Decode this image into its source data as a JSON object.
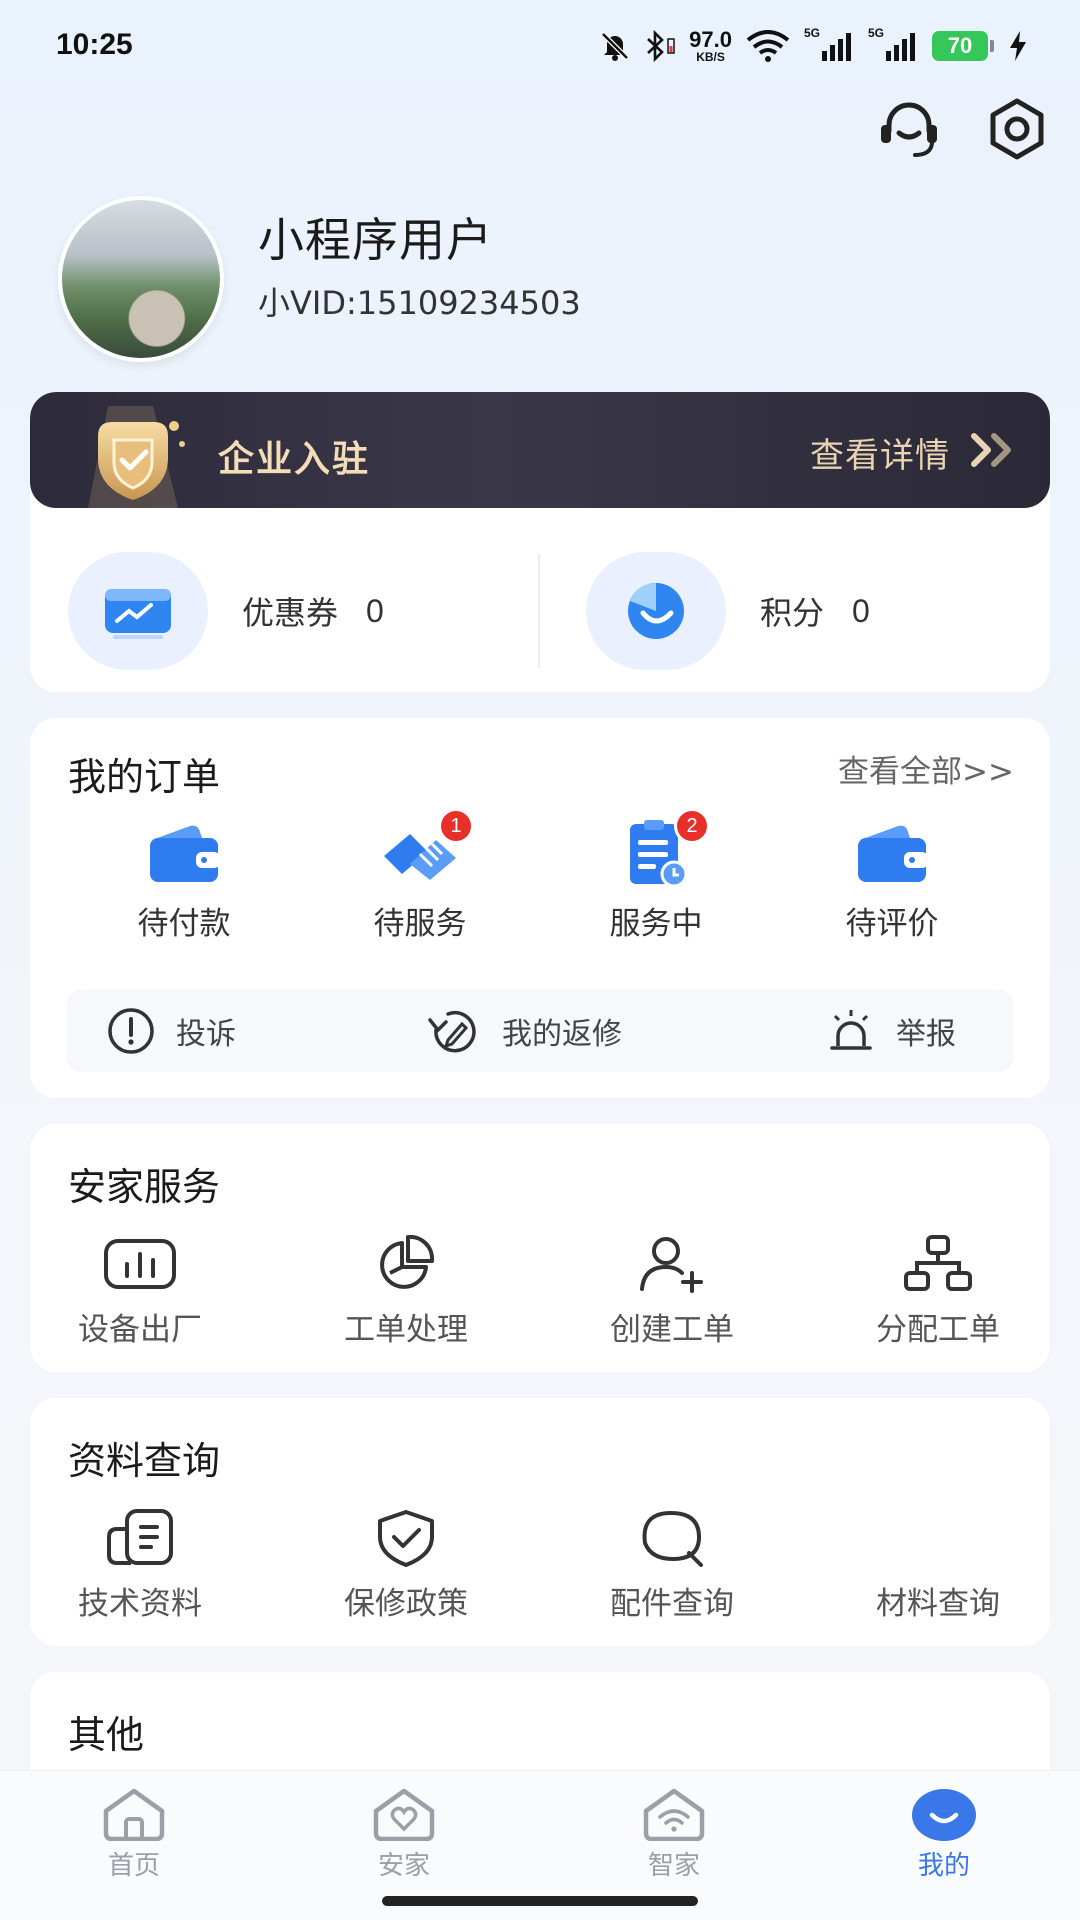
{
  "status_bar": {
    "time": "10:25",
    "net_speed_value": "97.0",
    "net_speed_unit": "KB/S",
    "signal_1_label": "5G",
    "signal_2_label": "5G",
    "battery": "70",
    "icons": [
      "mute-bell-icon",
      "bluetooth-icon",
      "wifi-icon",
      "signal-icon",
      "signal-icon",
      "battery-icon",
      "charging-icon"
    ]
  },
  "top_actions": [
    "customer-service-icon",
    "settings-icon"
  ],
  "profile": {
    "name": "小程序用户",
    "vid": "小VID:15109234503"
  },
  "enterprise": {
    "title": "企业入驻",
    "detail": "查看详情"
  },
  "assets": {
    "coupon_label": "优惠券",
    "coupon_value": "0",
    "points_label": "积分",
    "points_value": "0"
  },
  "orders": {
    "title": "我的订单",
    "see_all": "查看全部>>",
    "items": [
      {
        "label": "待付款",
        "icon": "wallet-icon"
      },
      {
        "label": "待服务",
        "icon": "handshake-icon",
        "badge": "1"
      },
      {
        "label": "服务中",
        "icon": "clipboard-clock-icon",
        "badge": "2"
      },
      {
        "label": "待评价",
        "icon": "wallet-icon"
      }
    ],
    "quick": [
      {
        "label": "投诉",
        "icon": "exclamation-circle-icon"
      },
      {
        "label": "我的返修",
        "icon": "repair-icon"
      },
      {
        "label": "举报",
        "icon": "alarm-icon"
      }
    ]
  },
  "anjia_service": {
    "title": "安家服务",
    "items": [
      {
        "label": "设备出厂",
        "icon": "bar-chart-icon"
      },
      {
        "label": "工单处理",
        "icon": "pie-chart-icon"
      },
      {
        "label": "创建工单",
        "icon": "add-user-icon"
      },
      {
        "label": "分配工单",
        "icon": "org-chart-icon"
      }
    ]
  },
  "info_query": {
    "title": "资料查询",
    "items": [
      {
        "label": "技术资料",
        "icon": "document-icon"
      },
      {
        "label": "保修政策",
        "icon": "shield-check-icon"
      },
      {
        "label": "配件查询",
        "icon": "search-bubble-icon"
      },
      {
        "label": "材料查询",
        "icon": ""
      }
    ]
  },
  "other": {
    "title": "其他"
  },
  "bottom_nav": [
    {
      "label": "首页",
      "icon": "home-icon"
    },
    {
      "label": "安家",
      "icon": "heart-house-icon"
    },
    {
      "label": "智家",
      "icon": "wifi-house-icon"
    },
    {
      "label": "我的",
      "icon": "smile-icon",
      "active": true
    }
  ],
  "colors": {
    "accent": "#3a77e8",
    "badge": "#e8302a",
    "banner_dark": "#2d2b3a",
    "banner_gold": "#f3dcb6"
  }
}
